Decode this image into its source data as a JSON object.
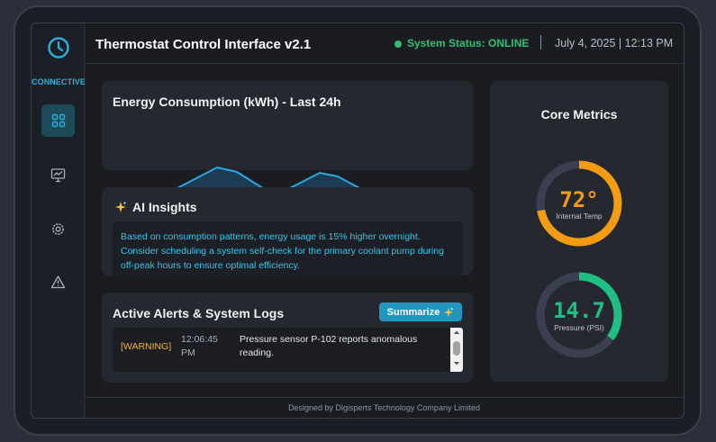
{
  "header": {
    "title": "Thermostat Control Interface v2.1",
    "status": "System Status: ONLINE",
    "date": "July 4, 2025",
    "time": "12:13 PM"
  },
  "sidebar": {
    "brand": "CONNECTIVE",
    "items": [
      {
        "icon": "dashboard-grid-icon",
        "active": true
      },
      {
        "icon": "chart-board-icon",
        "active": false
      },
      {
        "icon": "settings-gear-icon",
        "active": false
      },
      {
        "icon": "warning-triangle-icon",
        "active": false
      }
    ]
  },
  "energy": {
    "title": "Energy Consumption (kWh) - Last 24h"
  },
  "insights": {
    "title": "AI Insights",
    "text": "Based on consumption patterns, energy usage is 15% higher overnight. Consider scheduling a system self-check for the primary coolant pump during off-peak hours to ensure optimal efficiency."
  },
  "alerts": {
    "title": "Active Alerts & System Logs",
    "summarize_label": "Summarize",
    "logs": [
      {
        "level": "[WARNING]",
        "time": "12:06:45 PM",
        "message": "Pressure sensor P-102 reports anomalous reading."
      }
    ]
  },
  "metrics": {
    "title": "Core Metrics",
    "temp": {
      "value": "72°",
      "label": "Internal Temp",
      "fraction": 0.72
    },
    "pressure": {
      "value": "14.7",
      "label": "Pressure (PSI)",
      "fraction": 0.35
    }
  },
  "footer": {
    "text": "Designed by Digisperts Technology Company Limited"
  },
  "colors": {
    "accent": "#25b4e0",
    "online": "#2fbf71",
    "temp_gauge": "#f39c12",
    "pressure_gauge": "#1fbf84",
    "warning": "#f0b429"
  }
}
